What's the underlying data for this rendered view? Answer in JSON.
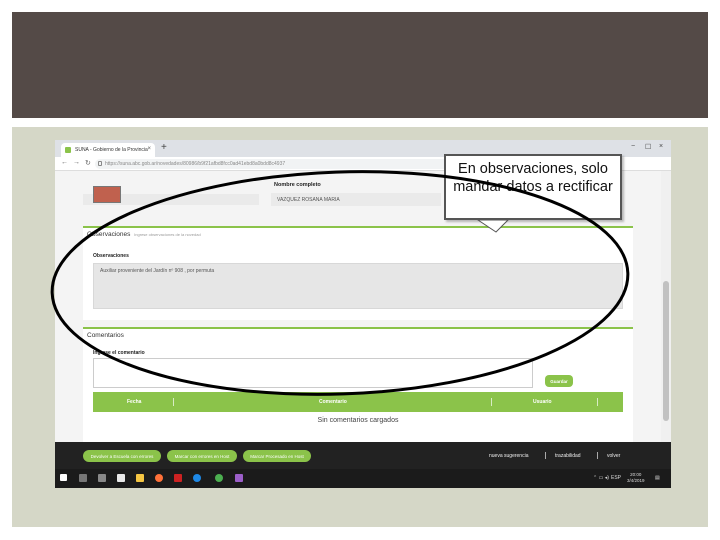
{
  "browser": {
    "tab_title": "SUNA - Gobierno de la Provincia",
    "tab_close": "×",
    "new_tab": "+",
    "win_minimize": "−",
    "win_maximize": "☐",
    "win_close": "×",
    "url": "https://suna.abc.gob.ar/novedades/80986/b9f21afbd8fcc0ad41ebd8a0bdd8c4937"
  },
  "form": {
    "nombre_label": "Nombre completo",
    "nombre_value": "VAZQUEZ ROSANA MARIA"
  },
  "observaciones": {
    "title": "Observaciones",
    "subtitle": "Ingrese observaciones de la novedad",
    "label": "Observaciones",
    "text": "Auxiliar proveniente del Jardín nº 908 , por permuta"
  },
  "comentarios": {
    "title": "Comentarios",
    "label": "Ingrese el comentario",
    "guardar": "Guardar",
    "columns": [
      "Fecha",
      "Comentario",
      "Usuario"
    ],
    "empty": "Sin comentarios cargados"
  },
  "actions": {
    "buttons": [
      "Devolver a Escuela con errores",
      "Marcar con errores en Host",
      "Marcar Procesado en Host"
    ],
    "links": [
      "nueva sugerencia",
      "trazabilidad",
      "volver"
    ]
  },
  "taskbar": {
    "lang": "ESP",
    "time": "20:00",
    "date": "3/4/2019"
  },
  "callout": {
    "text": "En observaciones, solo mandar datos a rectificar"
  },
  "colors": {
    "accent_green": "#8bc34a",
    "banner": "#544a47",
    "slide_bg": "#d5d7c7"
  }
}
